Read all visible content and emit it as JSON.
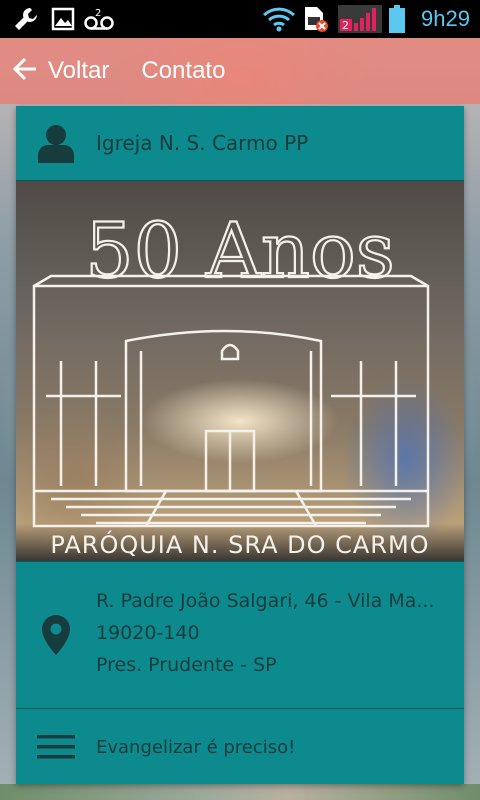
{
  "status_bar": {
    "time": "9h29",
    "icons": [
      "wrench-icon",
      "image-icon",
      "voicemail-icon",
      "wifi-icon",
      "sim-error-icon",
      "signal-icon",
      "battery-icon"
    ],
    "sim_badge": "2"
  },
  "action_bar": {
    "back_label": "Voltar",
    "title": "Contato",
    "background": "#ec786e"
  },
  "contact": {
    "name": "Igreja N. S. Carmo PP",
    "photo": {
      "headline": "50 Anos",
      "caption": "PARÓQUIA N. SRA DO CARMO"
    },
    "address": {
      "street": "R. Padre João Salgari, 46 - Vila Ma...",
      "postal_code": "19020-140",
      "city": "Pres. Prudente - SP"
    },
    "slogan": "Evangelizar é preciso!"
  },
  "colors": {
    "card": "#0d8a8d",
    "card_text": "#173c3e",
    "time": "#5cc8f0"
  }
}
